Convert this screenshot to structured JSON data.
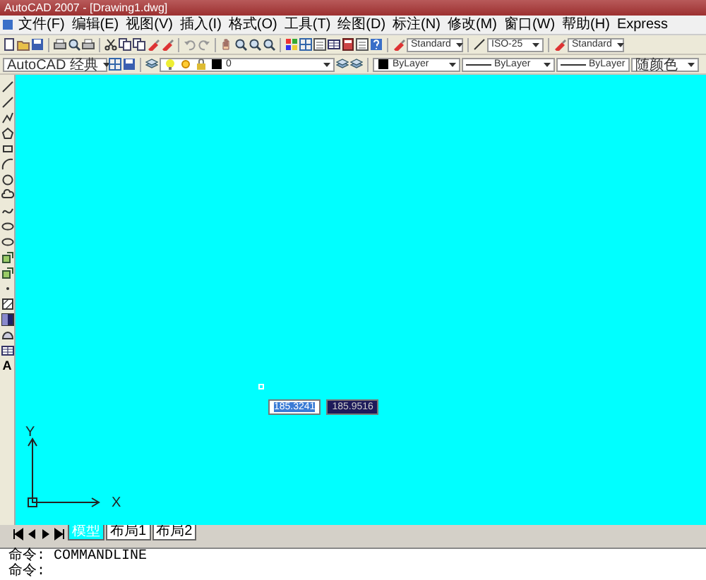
{
  "window": {
    "title": "AutoCAD 2007 - [Drawing1.dwg]"
  },
  "menu": [
    "文件(F)",
    "编辑(E)",
    "视图(V)",
    "插入(I)",
    "格式(O)",
    "工具(T)",
    "绘图(D)",
    "标注(N)",
    "修改(M)",
    "窗口(W)",
    "帮助(H)",
    "Express"
  ],
  "toolbar_1": {
    "text_style": "Standard",
    "dim_style": "ISO-25",
    "table_style": "Standard"
  },
  "toolbar_2": {
    "workspace": "AutoCAD 经典",
    "layer": "0",
    "object_color": "ByLayer",
    "linetype": "ByLayer",
    "lineweight": "ByLayer",
    "plot_style": "随颜色"
  },
  "draw_toolbar": {
    "text_tool": "A"
  },
  "dynamic_input": [
    {
      "value": "185.3241",
      "selected": true
    },
    {
      "value": "185.9516",
      "selected": false
    }
  ],
  "ucs": {
    "y_label": "Y",
    "x_label": "X"
  },
  "layout_tabs": [
    {
      "label": "模型",
      "selected": true
    },
    {
      "label": "布局1",
      "selected": false
    },
    {
      "label": "布局2",
      "selected": false
    }
  ],
  "command_lines": [
    "命令: COMMANDLINE",
    "命令:"
  ]
}
